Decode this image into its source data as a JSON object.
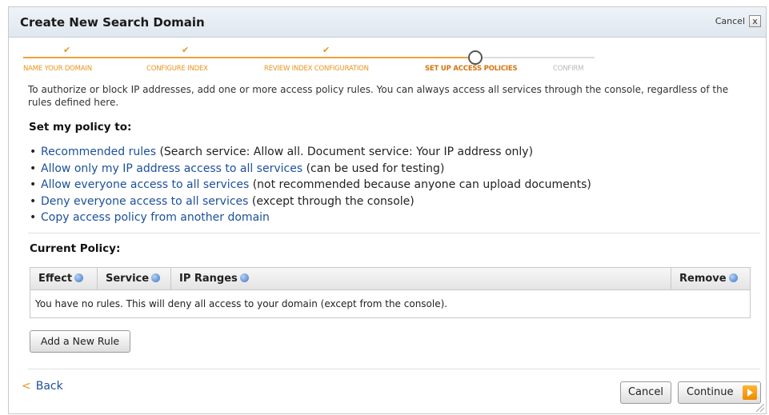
{
  "dialog": {
    "title": "Create New Search Domain",
    "close_label": "Cancel",
    "close_glyph": "x"
  },
  "wizard": {
    "check_glyph": "✔",
    "steps": [
      {
        "label": "NAME YOUR DOMAIN",
        "state": "done"
      },
      {
        "label": "CONFIGURE INDEX",
        "state": "done"
      },
      {
        "label": "REVIEW INDEX CONFIGURATION",
        "state": "done"
      },
      {
        "label": "SET UP ACCESS POLICIES",
        "state": "current"
      },
      {
        "label": "CONFIRM",
        "state": "future"
      }
    ]
  },
  "intro": "To authorize or block IP addresses, add one or more access policy rules. You can always access all services through the console, regardless of the rules defined here.",
  "policy": {
    "heading": "Set my policy to:",
    "bullet": "•",
    "options": [
      {
        "link": "Recommended rules",
        "note": " (Search service: Allow all. Document service: Your IP address only)"
      },
      {
        "link": "Allow only my IP address access to all services",
        "note": " (can be used for testing)"
      },
      {
        "link": "Allow everyone access to all services",
        "note": " (not recommended because anyone can upload documents)"
      },
      {
        "link": "Deny everyone access to all services",
        "note": " (except through the console)"
      },
      {
        "link": "Copy access policy from another domain",
        "note": ""
      }
    ]
  },
  "current_policy": {
    "heading": "Current Policy:",
    "columns": {
      "effect": "Effect",
      "service": "Service",
      "ip_ranges": "IP Ranges",
      "remove": "Remove"
    },
    "empty_message": "You have no rules. This will deny all access to your domain (except from the console)."
  },
  "buttons": {
    "add_rule": "Add a New Rule",
    "back_arrow": "<",
    "back": "Back",
    "cancel": "Cancel",
    "continue": "Continue"
  },
  "colors": {
    "accent_orange": "#f0a040",
    "link_blue": "#1c4f9c"
  }
}
